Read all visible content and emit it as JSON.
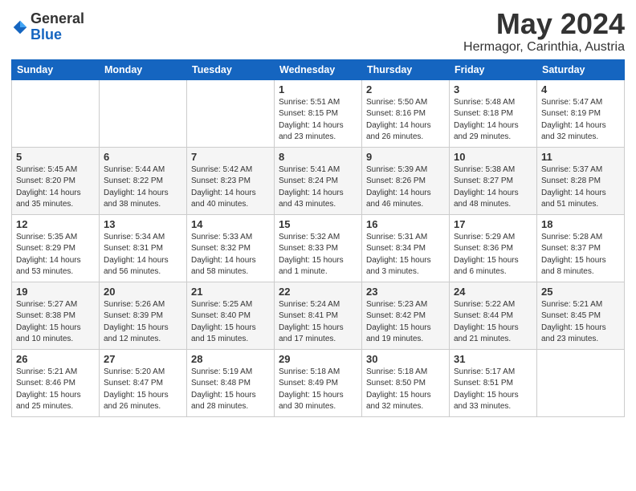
{
  "logo": {
    "general": "General",
    "blue": "Blue"
  },
  "title": "May 2024",
  "subtitle": "Hermagor, Carinthia, Austria",
  "headers": [
    "Sunday",
    "Monday",
    "Tuesday",
    "Wednesday",
    "Thursday",
    "Friday",
    "Saturday"
  ],
  "weeks": [
    [
      {
        "day": "",
        "info": ""
      },
      {
        "day": "",
        "info": ""
      },
      {
        "day": "",
        "info": ""
      },
      {
        "day": "1",
        "info": "Sunrise: 5:51 AM\nSunset: 8:15 PM\nDaylight: 14 hours\nand 23 minutes."
      },
      {
        "day": "2",
        "info": "Sunrise: 5:50 AM\nSunset: 8:16 PM\nDaylight: 14 hours\nand 26 minutes."
      },
      {
        "day": "3",
        "info": "Sunrise: 5:48 AM\nSunset: 8:18 PM\nDaylight: 14 hours\nand 29 minutes."
      },
      {
        "day": "4",
        "info": "Sunrise: 5:47 AM\nSunset: 8:19 PM\nDaylight: 14 hours\nand 32 minutes."
      }
    ],
    [
      {
        "day": "5",
        "info": "Sunrise: 5:45 AM\nSunset: 8:20 PM\nDaylight: 14 hours\nand 35 minutes."
      },
      {
        "day": "6",
        "info": "Sunrise: 5:44 AM\nSunset: 8:22 PM\nDaylight: 14 hours\nand 38 minutes."
      },
      {
        "day": "7",
        "info": "Sunrise: 5:42 AM\nSunset: 8:23 PM\nDaylight: 14 hours\nand 40 minutes."
      },
      {
        "day": "8",
        "info": "Sunrise: 5:41 AM\nSunset: 8:24 PM\nDaylight: 14 hours\nand 43 minutes."
      },
      {
        "day": "9",
        "info": "Sunrise: 5:39 AM\nSunset: 8:26 PM\nDaylight: 14 hours\nand 46 minutes."
      },
      {
        "day": "10",
        "info": "Sunrise: 5:38 AM\nSunset: 8:27 PM\nDaylight: 14 hours\nand 48 minutes."
      },
      {
        "day": "11",
        "info": "Sunrise: 5:37 AM\nSunset: 8:28 PM\nDaylight: 14 hours\nand 51 minutes."
      }
    ],
    [
      {
        "day": "12",
        "info": "Sunrise: 5:35 AM\nSunset: 8:29 PM\nDaylight: 14 hours\nand 53 minutes."
      },
      {
        "day": "13",
        "info": "Sunrise: 5:34 AM\nSunset: 8:31 PM\nDaylight: 14 hours\nand 56 minutes."
      },
      {
        "day": "14",
        "info": "Sunrise: 5:33 AM\nSunset: 8:32 PM\nDaylight: 14 hours\nand 58 minutes."
      },
      {
        "day": "15",
        "info": "Sunrise: 5:32 AM\nSunset: 8:33 PM\nDaylight: 15 hours\nand 1 minute."
      },
      {
        "day": "16",
        "info": "Sunrise: 5:31 AM\nSunset: 8:34 PM\nDaylight: 15 hours\nand 3 minutes."
      },
      {
        "day": "17",
        "info": "Sunrise: 5:29 AM\nSunset: 8:36 PM\nDaylight: 15 hours\nand 6 minutes."
      },
      {
        "day": "18",
        "info": "Sunrise: 5:28 AM\nSunset: 8:37 PM\nDaylight: 15 hours\nand 8 minutes."
      }
    ],
    [
      {
        "day": "19",
        "info": "Sunrise: 5:27 AM\nSunset: 8:38 PM\nDaylight: 15 hours\nand 10 minutes."
      },
      {
        "day": "20",
        "info": "Sunrise: 5:26 AM\nSunset: 8:39 PM\nDaylight: 15 hours\nand 12 minutes."
      },
      {
        "day": "21",
        "info": "Sunrise: 5:25 AM\nSunset: 8:40 PM\nDaylight: 15 hours\nand 15 minutes."
      },
      {
        "day": "22",
        "info": "Sunrise: 5:24 AM\nSunset: 8:41 PM\nDaylight: 15 hours\nand 17 minutes."
      },
      {
        "day": "23",
        "info": "Sunrise: 5:23 AM\nSunset: 8:42 PM\nDaylight: 15 hours\nand 19 minutes."
      },
      {
        "day": "24",
        "info": "Sunrise: 5:22 AM\nSunset: 8:44 PM\nDaylight: 15 hours\nand 21 minutes."
      },
      {
        "day": "25",
        "info": "Sunrise: 5:21 AM\nSunset: 8:45 PM\nDaylight: 15 hours\nand 23 minutes."
      }
    ],
    [
      {
        "day": "26",
        "info": "Sunrise: 5:21 AM\nSunset: 8:46 PM\nDaylight: 15 hours\nand 25 minutes."
      },
      {
        "day": "27",
        "info": "Sunrise: 5:20 AM\nSunset: 8:47 PM\nDaylight: 15 hours\nand 26 minutes."
      },
      {
        "day": "28",
        "info": "Sunrise: 5:19 AM\nSunset: 8:48 PM\nDaylight: 15 hours\nand 28 minutes."
      },
      {
        "day": "29",
        "info": "Sunrise: 5:18 AM\nSunset: 8:49 PM\nDaylight: 15 hours\nand 30 minutes."
      },
      {
        "day": "30",
        "info": "Sunrise: 5:18 AM\nSunset: 8:50 PM\nDaylight: 15 hours\nand 32 minutes."
      },
      {
        "day": "31",
        "info": "Sunrise: 5:17 AM\nSunset: 8:51 PM\nDaylight: 15 hours\nand 33 minutes."
      },
      {
        "day": "",
        "info": ""
      }
    ]
  ]
}
